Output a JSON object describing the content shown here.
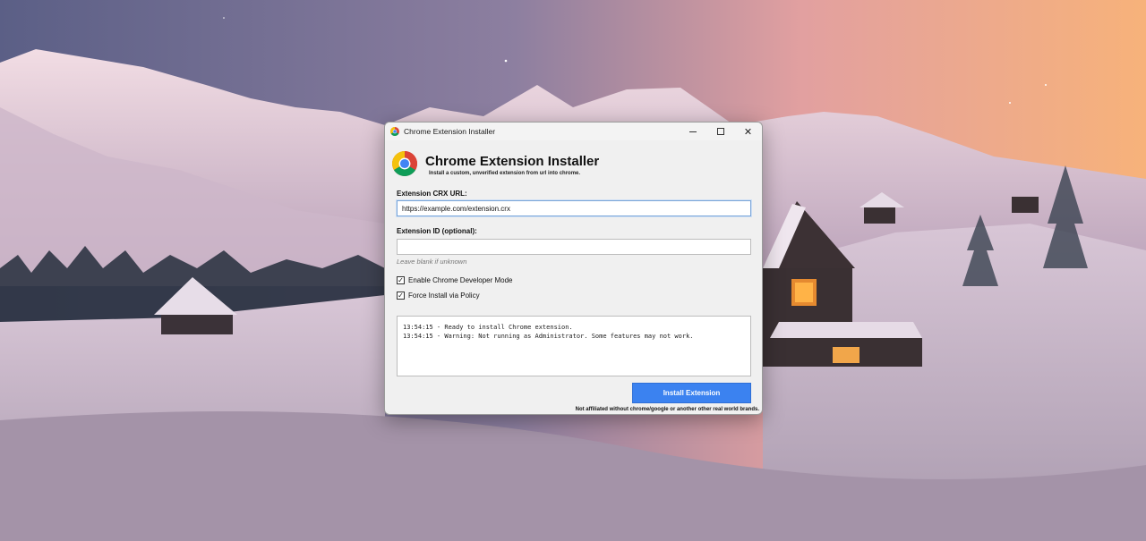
{
  "window": {
    "title": "Chrome Extension Installer",
    "controls": {
      "minimize": "minimize",
      "maximize": "maximize",
      "close": "✕"
    }
  },
  "header": {
    "title": "Chrome Extension Installer",
    "subtitle": "Install a custom, unverified extension from url into chrome."
  },
  "form": {
    "crx_url_label": "Extension CRX URL:",
    "crx_url_value": "https://example.com/extension.crx",
    "ext_id_label": "Extension ID (optional):",
    "ext_id_value": "",
    "ext_id_hint": "Leave blank if unknown",
    "dev_mode_label": "Enable Chrome Developer Mode",
    "dev_mode_checked": true,
    "policy_label": "Force Install via Policy",
    "policy_checked": true
  },
  "log": {
    "lines": [
      "13:54:15 - Ready to install Chrome extension.",
      "13:54:15 - Warning: Not running as Administrator. Some features may not work."
    ]
  },
  "actions": {
    "install_label": "Install Extension"
  },
  "footer": {
    "disclaimer": "Not affiliated without chrome/google or another other real world brands."
  },
  "colors": {
    "accent": "#3b82f0",
    "chrome_red": "#db4437",
    "chrome_yellow": "#f4c20d",
    "chrome_green": "#0f9d58",
    "chrome_blue": "#4285f4"
  }
}
